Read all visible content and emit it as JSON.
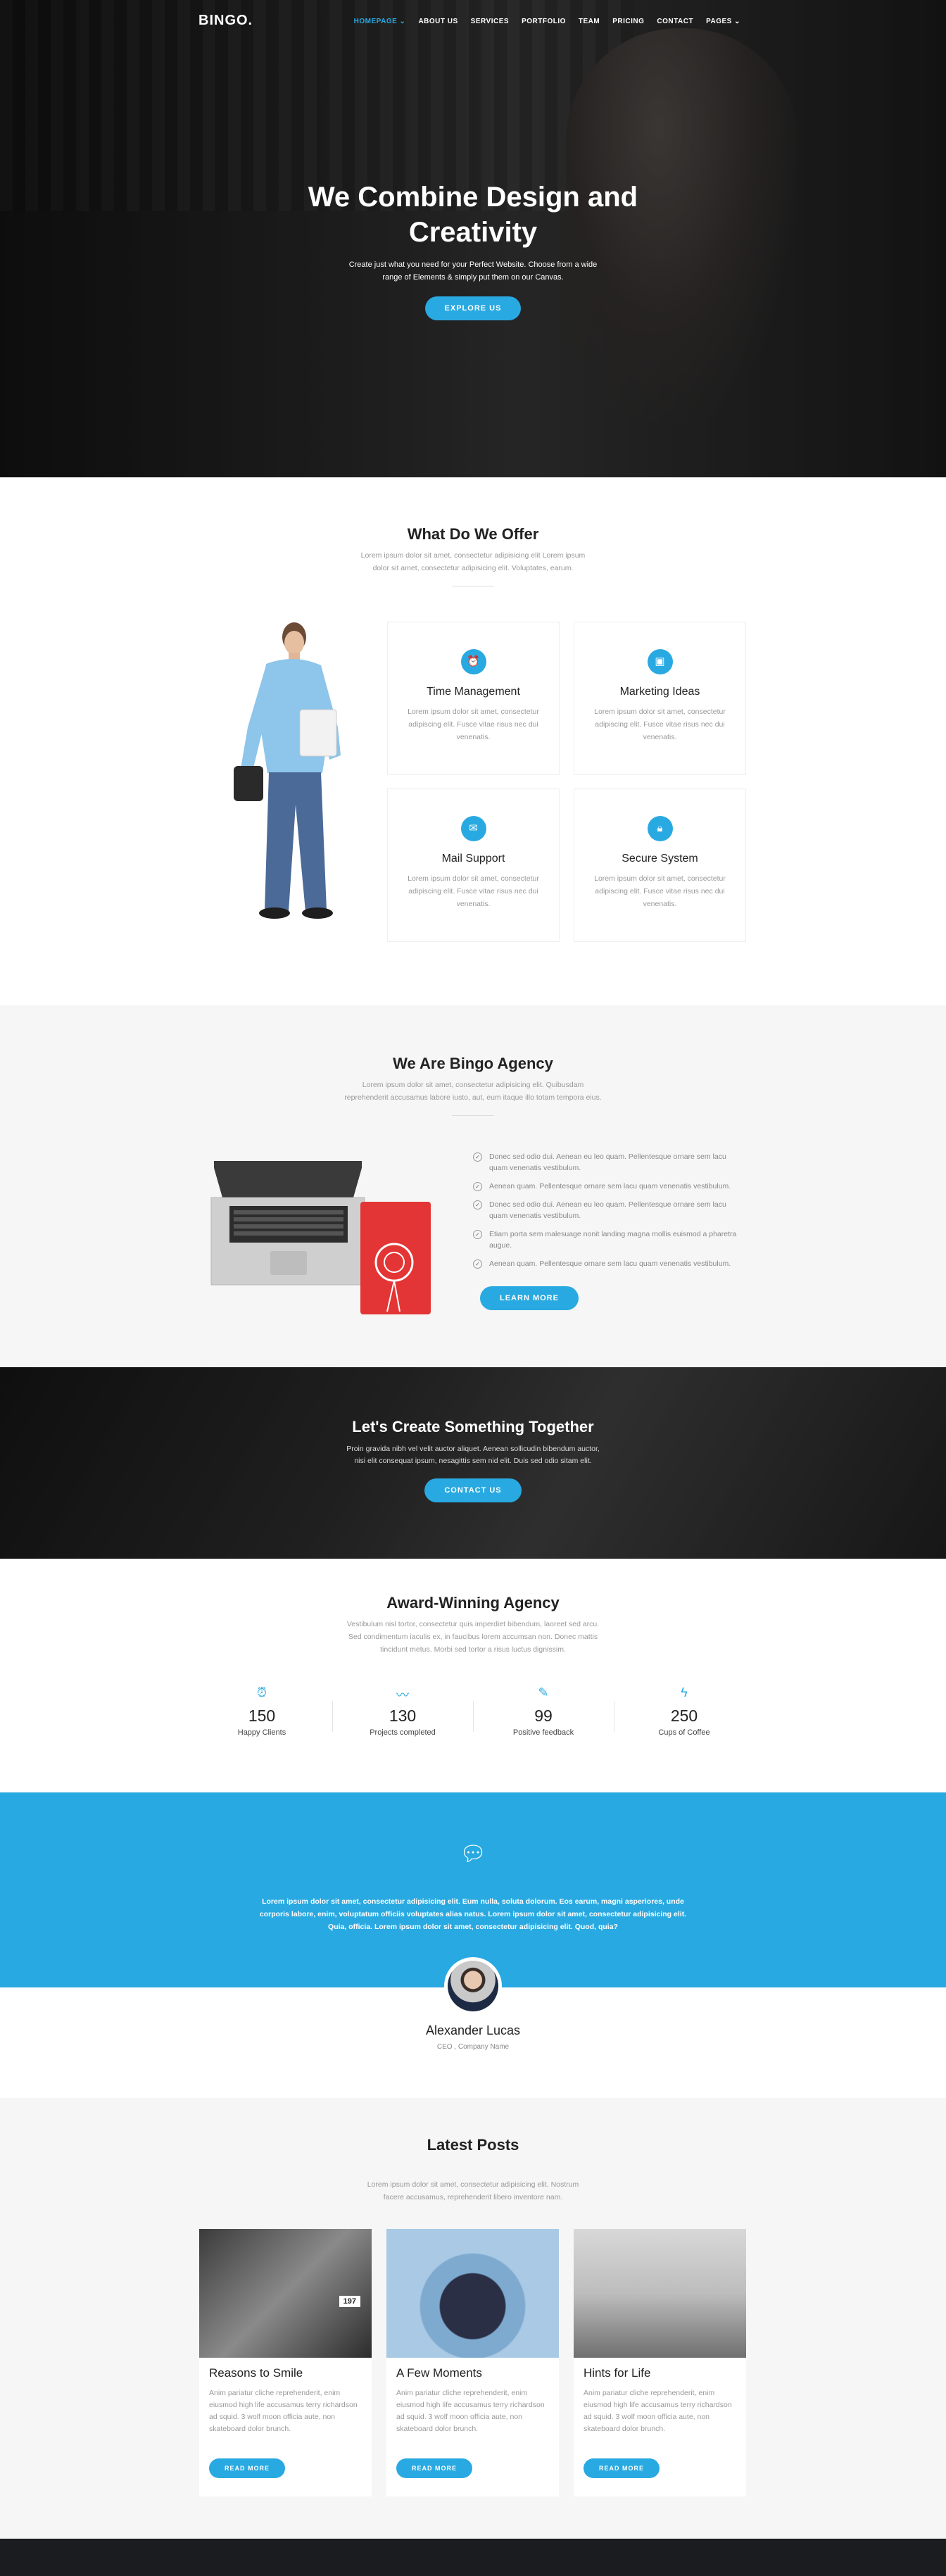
{
  "nav": {
    "logo": "BINGO.",
    "items": [
      {
        "label": "HOMEPAGE ⌄",
        "active": true
      },
      {
        "label": "ABOUT US"
      },
      {
        "label": "SERVICES"
      },
      {
        "label": "PORTFOLIO"
      },
      {
        "label": "TEAM"
      },
      {
        "label": "PRICING"
      },
      {
        "label": "CONTACT"
      },
      {
        "label": "PAGES ⌄"
      }
    ]
  },
  "hero": {
    "title": "We Combine Design and Creativity",
    "subtitle": "Create just what you need for your Perfect Website. Choose from a wide range of Elements & simply put them on our Canvas.",
    "button": "EXPLORE US"
  },
  "offer": {
    "title": "What Do We Offer",
    "subtitle": "Lorem ipsum dolor sit amet, consectetur adipisicing elit Lorem ipsum dolor sit amet, consectetur adipisicing elit. Voluptates, earum.",
    "cards": [
      {
        "icon": "alarm-clock-icon",
        "title": "Time Management",
        "text": "Lorem ipsum dolor sit amet, consectetur adipiscing elit. Fusce vitae risus nec dui venenatis."
      },
      {
        "icon": "briefcase-icon",
        "title": "Marketing Ideas",
        "text": "Lorem ipsum dolor sit amet, consectetur adipiscing elit. Fusce vitae risus nec dui venenatis."
      },
      {
        "icon": "mail-icon",
        "title": "Mail Support",
        "text": "Lorem ipsum dolor sit amet, consectetur adipiscing elit. Fusce vitae risus nec dui venenatis."
      },
      {
        "icon": "lock-icon",
        "title": "Secure System",
        "text": "Lorem ipsum dolor sit amet, consectetur adipiscing elit. Fusce vitae risus nec dui venenatis."
      }
    ]
  },
  "agency": {
    "title": "We Are Bingo Agency",
    "subtitle": "Lorem ipsum dolor sit amet, consectetur adipisicing elit. Quibusdam reprehenderit accusamus labore iusto, aut, eum itaque illo totam tempora eius.",
    "checks": [
      "Donec sed odio dui. Aenean eu leo quam. Pellentesque ornare sem lacu quam venenatis vestibulum.",
      "Aenean quam. Pellentesque ornare sem lacu quam venenatis vestibulum.",
      "Donec sed odio dui. Aenean eu leo quam. Pellentesque ornare sem lacu quam venenatis vestibulum.",
      "Etiam porta sem malesuage nonit landing magna mollis euismod a pharetra augue.",
      "Aenean quam. Pellentesque ornare sem lacu quam venenatis vestibulum."
    ],
    "button": "LEARN MORE"
  },
  "cta": {
    "title": "Let's Create Something Together",
    "subtitle": "Proin gravida nibh vel velit auctor aliquet. Aenean sollicudin bibendum auctor, nisi elit consequat ipsum, nesagittis sem nid elit. Duis sed odio sitam elit.",
    "button": "CONTACT US"
  },
  "award": {
    "title": "Award-Winning Agency",
    "subtitle": "Vestibulum nisl tortor, consectetur quis imperdiet bibendum, laoreet sed arcu. Sed condimentum iaculis ex, in faucibus lorem accumsan non. Donec mattis tincidunt metus. Morbi sed tortor a risus luctus dignissim.",
    "stats": [
      {
        "icon": "alarm-clock-icon",
        "value": "150",
        "label": "Happy Clients"
      },
      {
        "icon": "activity-icon",
        "value": "130",
        "label": "Projects completed"
      },
      {
        "icon": "edit-icon",
        "value": "99",
        "label": "Positive feedback"
      },
      {
        "icon": "lightning-icon",
        "value": "250",
        "label": "Cups of Coffee"
      }
    ]
  },
  "testimonial": {
    "quote": "Lorem ipsum dolor sit amet, consectetur adipisicing elit. Eum nulla, soluta dolorum. Eos earum, magni asperiores, unde corporis labore, enim, voluptatum officiis voluptates alias natus. Lorem ipsum dolor sit amet, consectetur adipisicing elit. Quia, officia. Lorem ipsum dolor sit amet, consectetur adipisicing elit. Quod, quia?",
    "name": "Alexander Lucas",
    "role": "CEO , Company Name"
  },
  "posts": {
    "title": "Latest Posts",
    "subtitle": "Lorem ipsum dolor sit amet, consectetur adipisicing elit. Nostrum facere accusamus, reprehenderit libero inventore nam.",
    "items": [
      {
        "title": "Reasons to Smile",
        "text": "Anim pariatur cliche reprehenderit, enim eiusmod high life accusamus terry richardson ad squid. 3 wolf moon officia aute, non skateboard dolor brunch.",
        "button": "READ MORE",
        "badge": "197"
      },
      {
        "title": "A Few Moments",
        "text": "Anim pariatur cliche reprehenderit, enim eiusmod high life accusamus terry richardson ad squid. 3 wolf moon officia aute, non skateboard dolor brunch.",
        "button": "READ MORE"
      },
      {
        "title": "Hints for Life",
        "text": "Anim pariatur cliche reprehenderit, enim eiusmod high life accusamus terry richardson ad squid. 3 wolf moon officia aute, non skateboard dolor brunch.",
        "button": "READ MORE"
      }
    ]
  },
  "colors": {
    "accent": "#29a9e1",
    "dark": "#1b1c1f",
    "light_bg": "#f6f6f6"
  }
}
